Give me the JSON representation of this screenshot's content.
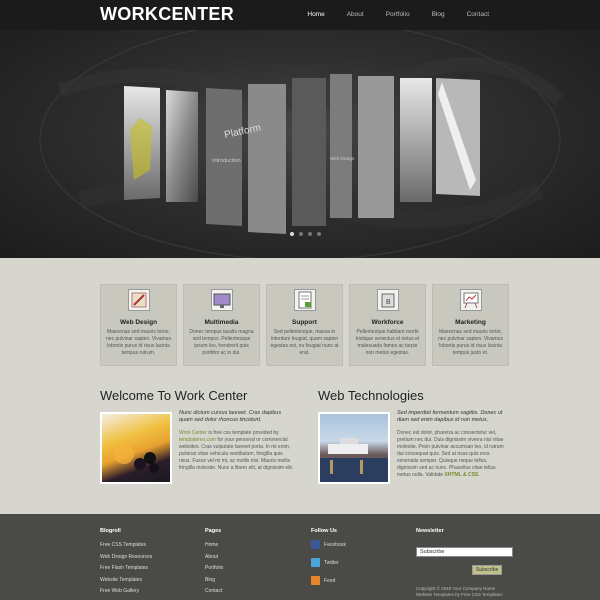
{
  "header": {
    "logo": "WORKCENTER",
    "nav": [
      "Home",
      "About",
      "Portfolio",
      "Blog",
      "Contact"
    ]
  },
  "banner": {
    "slide_texts": [
      "Platform",
      "Introduction",
      "Web Design"
    ],
    "dots": 4,
    "active_dot": 0
  },
  "services": [
    {
      "title": "Web Design",
      "text": "Maecenas sed mauris tortor, nec pulvinar sapien. Vivamus lobortis purus id risus lacinia tempus rutrum."
    },
    {
      "title": "Multimedia",
      "text": "Donec tempus iaculis magna sed tempus. Pellentesque ipsum leo, hendrerit quis porttitor ac in dui."
    },
    {
      "title": "Support",
      "text": "Sed pellentesque, massa in interdum feugiat, quam sapien egestas est, eu feugiat nunc at erat."
    },
    {
      "title": "Workforce",
      "text": "Pellentesque habitant morbi tristique senectus et netus et malesuada fames ac turpis non metus egestas."
    },
    {
      "title": "Marketing",
      "text": "Maecenas sed mauris tortor, nec pulvinar sapien. Vivamus lobortis purus id risus lacinia tempus justo et."
    }
  ],
  "welcome": {
    "title": "Welcome To Work Center",
    "lead": "Nunc dictum cursus laoreet. Cras dapibus quam sed dolor rhoncus tincidunt.",
    "link1": "Work Center",
    "text1": " is free css template provided by ",
    "link2": "templatemo.com",
    "text2": " for your personal or commercial websites. Cras vulputate laoreet porta. In mi enim, pulvinar vitae vehicula vestibulum, fringilla quis risus. Fusce vel mi mi, ac mollis nisi. Mauris mollis fringilla molestie. Nunc a libero elit, at dignissim elit."
  },
  "tech": {
    "title": "Web Technologies",
    "lead": "Sed imperdiet fermentum sagittis. Donec ut diam sed enim dapibus id non metus.",
    "text": "Donec est dolor, pharetra ac consectetur vel, pretium nec dui. Duis dignissim viverra nisi vitae molestie. Proin pulvinar accumsan leo, id rutrum dui consequat quis. Sed at risus quis eros venenatis semper. Quisque neque tellus, dignissim sed ac nunc. Phasellus vitae tellus metus nulla. Validate ",
    "xhtml": "XHTML",
    "amp": " & ",
    "css": "CSS",
    "end": "."
  },
  "footer": {
    "blogroll": {
      "title": "Blogroll",
      "items": [
        "Free CSS Templates",
        "Web Design Resources",
        "Free Flash Templates",
        "Website Templates",
        "Free Web Gallery"
      ]
    },
    "pages": {
      "title": "Pages",
      "items": [
        "Home",
        "About",
        "Portfolio",
        "Blog",
        "Contact"
      ]
    },
    "follow": {
      "title": "Follow Us",
      "items": [
        "Facebook",
        "Twitter",
        "Feed"
      ]
    },
    "newsletter": {
      "title": "Newsletter",
      "input_value": "Subscribe",
      "button": "Subscribe",
      "copyright": "Copyright © 2048 Your Company Name",
      "credit": "Website Templates by Free CSS Templates"
    }
  },
  "colors": {
    "header_bg": "#1b1b1b",
    "body_bg": "#d6d6cf",
    "footer_bg": "#4a4a47",
    "accent_green": "#7a8a2a"
  }
}
